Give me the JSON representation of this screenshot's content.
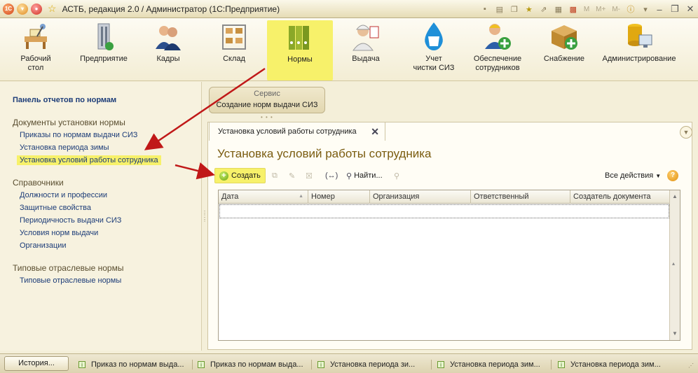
{
  "window": {
    "title": "АСТБ, редакция 2.0 / Администратор  (1С:Предприятие)",
    "m_buttons": [
      "M",
      "M+",
      "M-"
    ]
  },
  "sections": [
    {
      "label": "Рабочий\nстол",
      "icon": "desk-icon"
    },
    {
      "label": "Предприятие",
      "icon": "building-icon"
    },
    {
      "label": "Кадры",
      "icon": "people-icon"
    },
    {
      "label": "Склад",
      "icon": "warehouse-icon"
    },
    {
      "label": "Нормы",
      "icon": "binders-icon",
      "active": true
    },
    {
      "label": "Выдача",
      "icon": "worker-icon"
    },
    {
      "label": "Учет\nчистки СИЗ",
      "icon": "water-drop-icon"
    },
    {
      "label": "Обеспечение\nсотрудников",
      "icon": "person-add-icon"
    },
    {
      "label": "Снабжение",
      "icon": "box-add-icon"
    },
    {
      "label": "Администрирование",
      "icon": "database-icon"
    }
  ],
  "left_panel": {
    "header": "Панель отчетов по нормам",
    "group1": {
      "title": "Документы установки нормы",
      "items": [
        "Приказы по нормам выдачи СИЗ",
        "Установка периода зимы",
        "Установка условий работы сотрудника"
      ]
    },
    "group2": {
      "title": "Справочники",
      "items": [
        "Должности и профессии",
        "Защитные свойства",
        "Периодичность выдачи СИЗ",
        "Условия норм выдачи",
        "Организации"
      ]
    },
    "group3": {
      "title": "Типовые отраслевые нормы",
      "items": [
        "Типовые отраслевые нормы"
      ]
    }
  },
  "service": {
    "title": "Сервис",
    "item": "Создание норм выдачи СИЗ"
  },
  "tab": {
    "label": "Установка условий работы сотрудника"
  },
  "form": {
    "title": "Установка условий работы сотрудника",
    "create_label": "Создать",
    "find_label": "Найти...",
    "all_actions_label": "Все действия",
    "columns": [
      "Дата",
      "Номер",
      "Организация",
      "Ответственный",
      "Создатель документа"
    ]
  },
  "taskbar": {
    "history_label": "История...",
    "tasks": [
      "Приказ по нормам выда...",
      "Приказ по нормам выда...",
      "Установка периода зи...",
      "Установка периода зим...",
      "Установка периода зим..."
    ]
  },
  "colors": {
    "highlight": "#f7f16a",
    "arrow": "#c01818",
    "link": "#1c3c78"
  }
}
